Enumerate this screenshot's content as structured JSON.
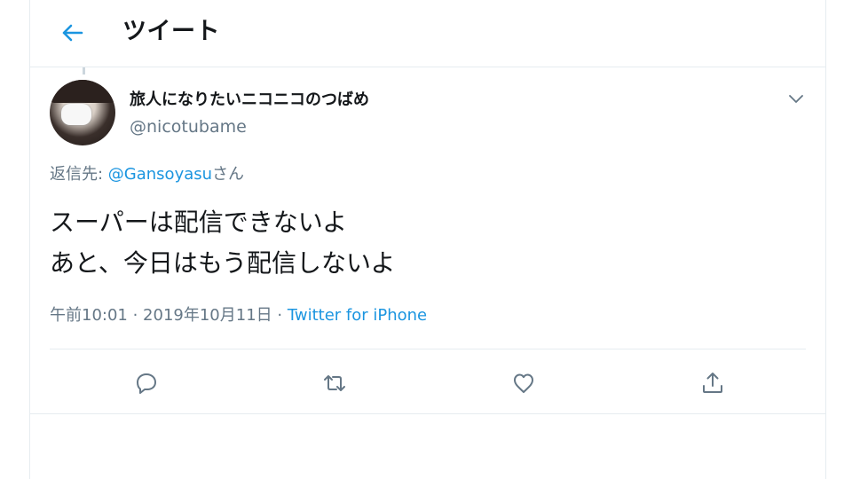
{
  "header": {
    "title": "ツイート",
    "back_icon": "arrow-left-icon"
  },
  "colors": {
    "accent": "#1b95e0",
    "secondary_text": "#657786",
    "border": "#e6ecf0"
  },
  "tweet": {
    "display_name": "旅人になりたいニコニコのつばめ",
    "username": "@nicotubame",
    "reply_prefix": "返信先: ",
    "reply_to": "@Gansoyasu",
    "reply_suffix": "さん",
    "text_line1": "スーパーは配信できないよ",
    "text_line2": "あと、今日はもう配信しないよ",
    "time": "午前10:01",
    "separator": " · ",
    "date": "2019年10月11日",
    "source": "Twitter for iPhone"
  },
  "actions": {
    "reply_icon": "reply-icon",
    "retweet_icon": "retweet-icon",
    "like_icon": "heart-icon",
    "share_icon": "share-icon"
  }
}
